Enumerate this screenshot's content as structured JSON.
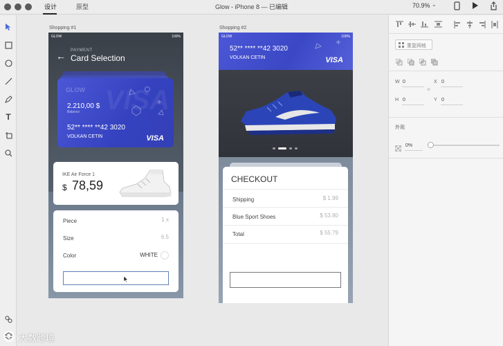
{
  "titlebar": {
    "tab_design": "设计",
    "tab_prototype": "原型",
    "document_title": "Glow - iPhone 8 — 已编辑",
    "zoom": "70.9%"
  },
  "artboards": {
    "a1_label": "Shopping #1",
    "a2_label": "Shopping #2"
  },
  "phone1": {
    "status_left": "GLOW",
    "status_right": "100%",
    "header_small": "PAYMENT",
    "header_title": "Card Selection",
    "card": {
      "brand": "GLOW",
      "balance": "2.210,00 $",
      "balance_caption": "Balance",
      "number": "52** **** **42 3020",
      "holder": "VOLKAN CETIN",
      "network": "VISA",
      "watermark": "VISA"
    },
    "product": {
      "name": "IKE Air Force 1",
      "currency": "$",
      "price": "78,59"
    },
    "details": [
      {
        "label": "Piece",
        "value": "1 x"
      },
      {
        "label": "Size",
        "value": "6.5"
      },
      {
        "label": "Color",
        "value": "WHITE"
      }
    ]
  },
  "phone2": {
    "status_left": "GLOW",
    "status_right": "100%",
    "card_number": "52** **** **42 3020",
    "card_holder": "VOLKAN CETIN",
    "card_network": "VISA",
    "checkout_title": "CHECKOUT",
    "lines": [
      {
        "label": "Shipping",
        "value": "$ 1.99"
      },
      {
        "label": "Blue Sport Shoes",
        "value": "$ 53.80"
      },
      {
        "label": "Total",
        "value": "$ 55.79"
      }
    ],
    "carousel_active": 2
  },
  "inspector": {
    "button_label": "重复网格",
    "w_label": "W",
    "w_value": "0",
    "x_label": "X",
    "x_value": "0",
    "h_label": "H",
    "h_value": "0",
    "y_label": "Y",
    "y_value": "0",
    "appearance_label": "外观",
    "opacity_value": "0%"
  },
  "watermark": {
    "text": "大数跨境"
  },
  "colors": {
    "card_blue": "#3d49c8",
    "visa_text": "#ffffff",
    "panel_bg": "#f5f5f5"
  }
}
